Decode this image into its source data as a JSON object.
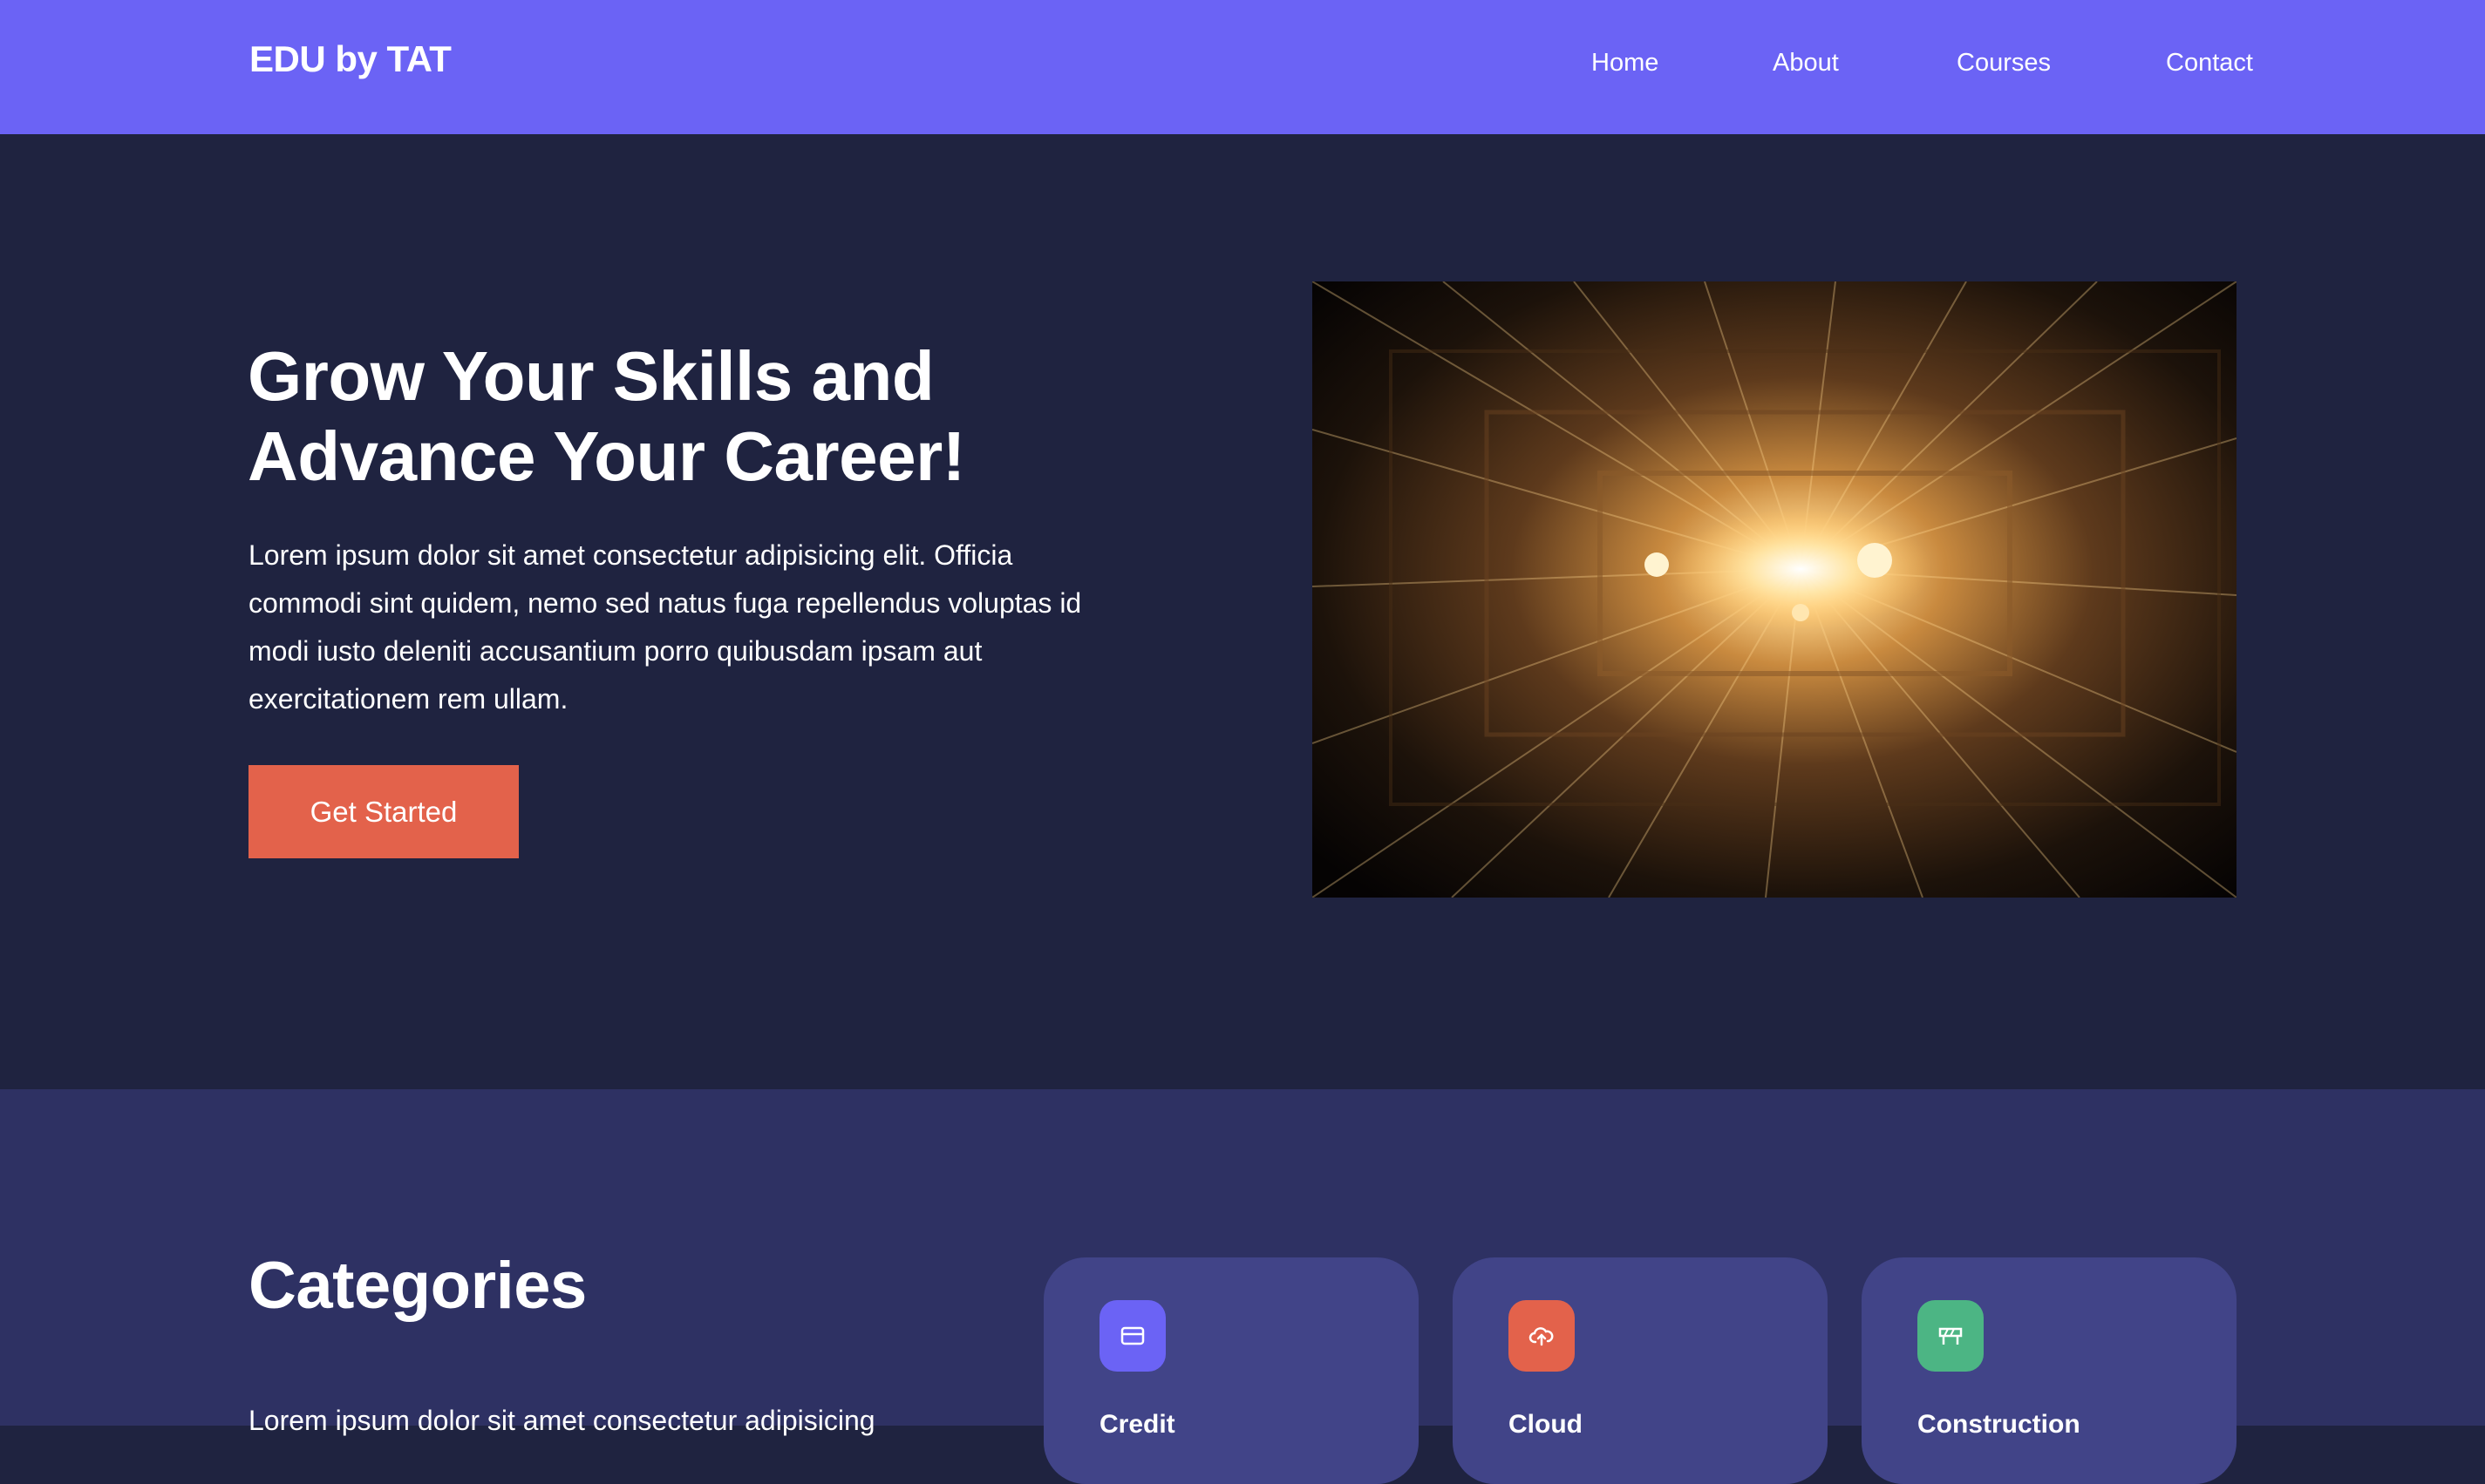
{
  "nav": {
    "brand": "EDU by TAT",
    "links": [
      {
        "label": "Home"
      },
      {
        "label": "About"
      },
      {
        "label": "Courses"
      },
      {
        "label": "Contact"
      }
    ]
  },
  "hero": {
    "title_line1": "Grow Your Skills and",
    "title_line2": "Advance Your Career!",
    "text_lines": [
      "Lorem ipsum dolor sit amet consectetur adipisicing elit. Officia",
      "commodi sint quidem, nemo sed natus fuga repellendus voluptas id",
      "modi iusto deleniti accusantium porro quibusdam ipsam aut",
      "exercitationem rem ullam."
    ],
    "cta_label": "Get Started"
  },
  "categories": {
    "title": "Categories",
    "text": "Lorem ipsum dolor sit amet consectetur adipisicing",
    "cards": [
      {
        "label": "Credit",
        "icon": "credit-card-icon",
        "color": "#6b63f5"
      },
      {
        "label": "Cloud",
        "icon": "cloud-upload-icon",
        "color": "#e3624b"
      },
      {
        "label": "Construction",
        "icon": "road-barrier-icon",
        "color": "#4cb584"
      }
    ]
  },
  "colors": {
    "navbar": "#6b63f5",
    "hero_bg": "#1f2340",
    "categories_bg": "#2e3163",
    "card_bg": "#414488",
    "cta": "#e3624b"
  }
}
